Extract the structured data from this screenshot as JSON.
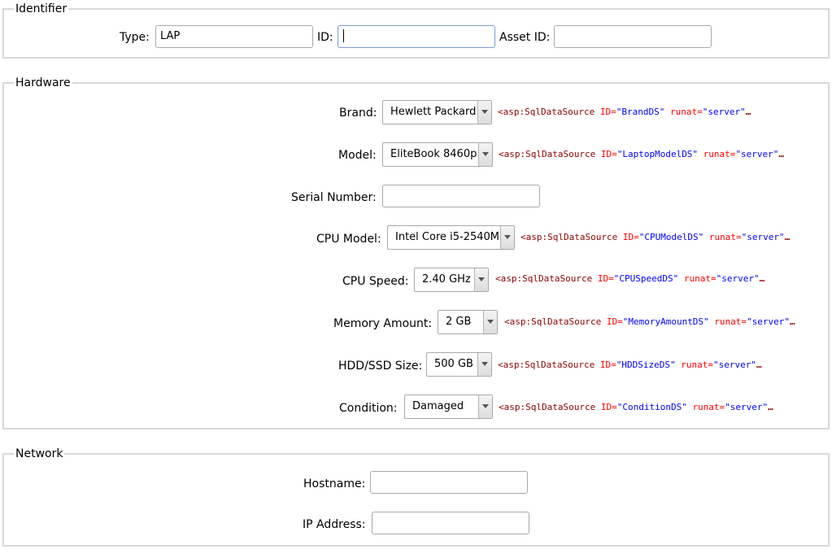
{
  "identifier": {
    "legend": "Identifier",
    "type_label": "Type:",
    "type_value": "LAP",
    "id_label": "ID:",
    "id_value": "",
    "asset_label": "Asset ID:",
    "asset_value": ""
  },
  "hardware": {
    "legend": "Hardware",
    "brand": {
      "label": "Brand:",
      "value": "Hewlett Packard",
      "ds_tag": "<asp:SqlDataSource",
      "ds_id_attr": "ID=",
      "ds_id": "\"BrandDS\"",
      "ds_runat_attr": "runat=",
      "ds_runat": "\"server\"",
      "ellipsis": "…"
    },
    "model": {
      "label": "Model:",
      "value": "EliteBook 8460p",
      "ds_tag": "<asp:SqlDataSource",
      "ds_id_attr": "ID=",
      "ds_id": "\"LaptopModelDS\"",
      "ds_runat_attr": "runat=",
      "ds_runat": "\"server\"",
      "ellipsis": "…"
    },
    "serial": {
      "label": "Serial Number:",
      "value": ""
    },
    "cpu_model": {
      "label": "CPU Model:",
      "value": "Intel Core i5-2540M",
      "ds_tag": "<asp:SqlDataSource",
      "ds_id_attr": "ID=",
      "ds_id": "\"CPUModelDS\"",
      "ds_runat_attr": "runat=",
      "ds_runat": "\"server\"",
      "ellipsis": "…"
    },
    "cpu_speed": {
      "label": "CPU Speed:",
      "value": "2.40 GHz",
      "ds_tag": "<asp:SqlDataSource",
      "ds_id_attr": "ID=",
      "ds_id": "\"CPUSpeedDS\"",
      "ds_runat_attr": "runat=",
      "ds_runat": "\"server\"",
      "ellipsis": "…"
    },
    "memory": {
      "label": "Memory Amount:",
      "value": "2 GB",
      "ds_tag": "<asp:SqlDataSource",
      "ds_id_attr": "ID=",
      "ds_id": "\"MemoryAmountDS\"",
      "ds_runat_attr": "runat=",
      "ds_runat": "\"server\"",
      "ellipsis": "…"
    },
    "hdd": {
      "label": "HDD/SSD Size:",
      "value": "500 GB",
      "ds_tag": "<asp:SqlDataSource",
      "ds_id_attr": "ID=",
      "ds_id": "\"HDDSizeDS\"",
      "ds_runat_attr": "runat=",
      "ds_runat": "\"server\"",
      "ellipsis": "…"
    },
    "condition": {
      "label": "Condition:",
      "value": "Damaged",
      "ds_tag": "<asp:SqlDataSource",
      "ds_id_attr": "ID=",
      "ds_id": "\"ConditionDS\"",
      "ds_runat_attr": "runat=",
      "ds_runat": "\"server\"",
      "ellipsis": "…"
    }
  },
  "network": {
    "legend": "Network",
    "hostname_label": "Hostname:",
    "hostname_value": "",
    "ip_label": "IP Address:",
    "ip_value": ""
  }
}
